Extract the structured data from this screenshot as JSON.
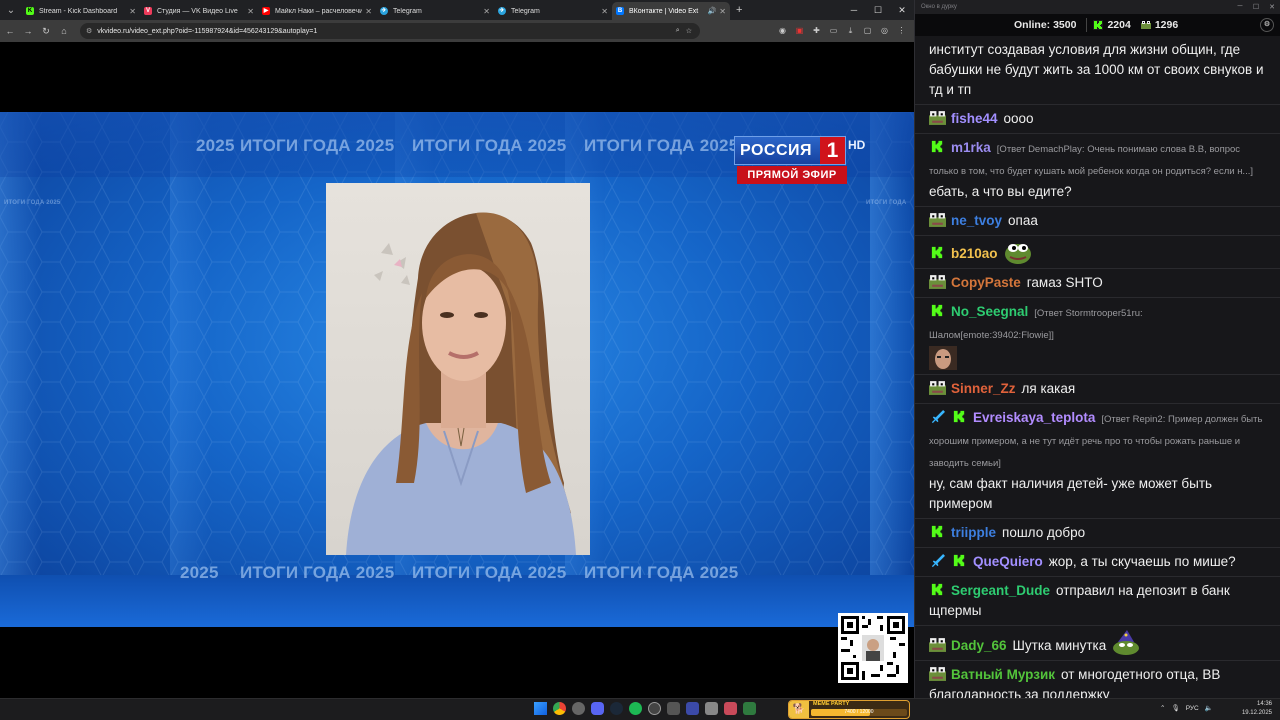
{
  "browser": {
    "tabs": [
      {
        "title": "Stream - Kick Dashboard",
        "color": "#53fc18",
        "glyph": "K"
      },
      {
        "title": "Студия — VK Видео Live",
        "color": "#ee3b5b",
        "glyph": "V"
      },
      {
        "title": "Майкл Наки – расчеловечиван",
        "color": "#ff0000",
        "glyph": "▶"
      },
      {
        "title": "Telegram",
        "color": "#2aa3de",
        "glyph": "✈"
      },
      {
        "title": "Telegram",
        "color": "#2aa3de",
        "glyph": "✈"
      },
      {
        "title": "ВКонтакте | Video Ext",
        "color": "#0077ff",
        "glyph": "В",
        "active": true
      }
    ],
    "url": "vkvideo.ru/video_ext.php?oid=-115987924&id=456243129&autoplay=1"
  },
  "video": {
    "banner_text": "ИТОГИ ГОДА",
    "banner_year": "2025",
    "channel_name": "РОССИЯ",
    "channel_number": "1",
    "channel_hd": "HD",
    "live_label": "ПРЯМОЙ ЭФИР"
  },
  "chat": {
    "window_title": "Окно в дурку",
    "online_label": "Online:",
    "online_count": "3500",
    "kick_count": "2204",
    "other_count": "1296",
    "messages": [
      {
        "nick": "",
        "color": "#efefef",
        "badge": "none",
        "text": "институт создавая условия для жизни общин, где бабушки не будут жить за 1000 км от своих свнуков и тд и тп"
      },
      {
        "nick": "fishe44",
        "color": "#a28fff",
        "badge": "sub",
        "text": "оооо"
      },
      {
        "nick": "m1rka",
        "color": "#9b8cf0",
        "badge": "kick",
        "reply": "[Ответ DemachPlay: Очень понимаю слова В.В, вопрос только в том, что будет кушать мой ребенок когда он родиться? если н...]",
        "text": "ебать, а что вы едите?"
      },
      {
        "nick": "ne_tvoy",
        "color": "#3d7fe0",
        "badge": "sub",
        "text": "опаа"
      },
      {
        "nick": "b210ao",
        "color": "#f2c14e",
        "badge": "kick",
        "text": "",
        "emote": "pepe"
      },
      {
        "nick": "CopyPaste",
        "color": "#d4763b",
        "badge": "sub",
        "text": "гамаз SHTO"
      },
      {
        "nick": "No_Seegnal",
        "color": "#2ecc71",
        "badge": "kick",
        "reply": "[Ответ Stormtrooper51ru: Шалом[emote:39402:Flowie]]",
        "text": "",
        "emote": "face"
      },
      {
        "nick": "Sinner_Zz",
        "color": "#e0623b",
        "badge": "sub",
        "text": "ля какая"
      },
      {
        "nick": "Evreiskaya_teplota",
        "color": "#b28cff",
        "badge": "sword+kick",
        "reply": "[Ответ Repin2: Пример должен быть хорошим примером, а не тут идёт речь про то чтобы рожать раньше и заводить семьи]",
        "text": "ну, сам факт наличия детей- уже может быть примером"
      },
      {
        "nick": "triipple",
        "color": "#3d7fe0",
        "badge": "kick",
        "text": "пошло добро"
      },
      {
        "nick": "QueQuiero",
        "color": "#a28fff",
        "badge": "sword+kick",
        "text": "жор, а ты скучаешь по мише?"
      },
      {
        "nick": "Sergeant_Dude",
        "color": "#2ecc71",
        "badge": "kick",
        "text": "отправил на депозит в банк щпермы"
      },
      {
        "nick": "Dady_66",
        "color": "#53c43b",
        "badge": "sub",
        "text": "Шутка минутка",
        "emote": "wizard"
      },
      {
        "nick": "Ватный Мурзик",
        "color": "#53c43b",
        "badge": "sub",
        "text": "от многодетного отца, ВВ благодарность за поддержку"
      }
    ]
  },
  "taskbar": {
    "lang": "РУС",
    "time": "14:36",
    "date": "19.12.2025",
    "widget_title": "MEME PARTY",
    "widget_progress": "7400 / 12000"
  },
  "colors": {
    "kick_green": "#53fc18",
    "russia_red": "#d0131b",
    "video_blue": "#1565c8"
  }
}
